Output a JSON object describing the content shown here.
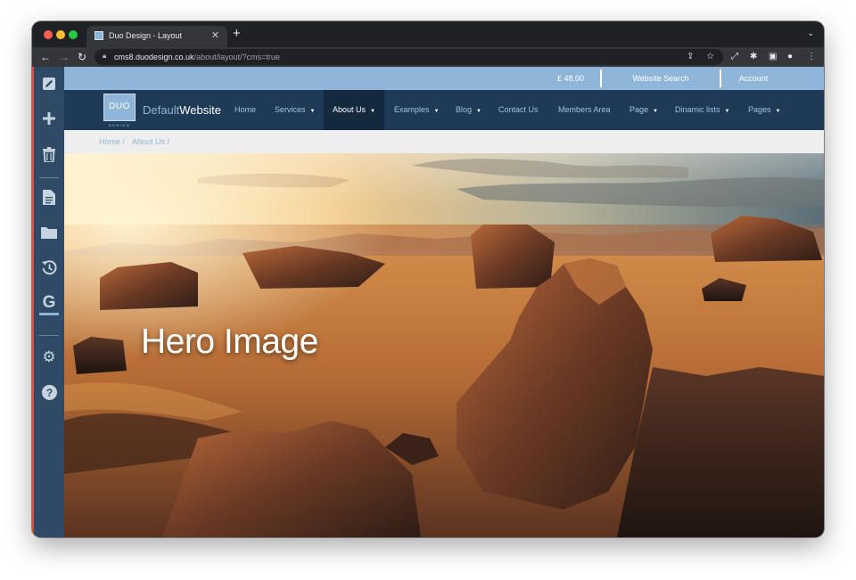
{
  "browser": {
    "tab_title": "Duo Design - Layout",
    "tab_close": "✕",
    "new_tab": "+",
    "url_host": "cms8.duodesign.co.uk",
    "url_path": "/about/layout/?cms=true"
  },
  "cms_sidebar": {
    "icons": [
      "edit-icon",
      "add-icon",
      "trash-icon",
      "page-icon",
      "folder-icon",
      "history-icon",
      "google-icon",
      "settings-icon",
      "help-icon"
    ]
  },
  "util_bar": {
    "basket": "£ 48.00",
    "search": "Website Search",
    "account": "Account"
  },
  "logo": {
    "text": "DUO",
    "sub": "DESIGN",
    "site_name_light": "Default",
    "site_name_bold": "Website"
  },
  "nav": {
    "items": [
      {
        "label": "Home",
        "dropdown": false
      },
      {
        "label": "Services",
        "dropdown": true
      },
      {
        "label": "About Us",
        "dropdown": true,
        "active": true
      },
      {
        "label": "Examples",
        "dropdown": true
      },
      {
        "label": "Blog",
        "dropdown": true
      },
      {
        "label": "Contact Us",
        "dropdown": false
      },
      {
        "label": "Members Area",
        "dropdown": false
      },
      {
        "label": "Page",
        "dropdown": true
      },
      {
        "label": "Dinamic lists",
        "dropdown": true
      },
      {
        "label": "Pages",
        "dropdown": true
      }
    ],
    "caret": "▼"
  },
  "breadcrumb": {
    "home": "Home /",
    "about": "About Us /"
  },
  "hero": {
    "title": "Hero Image"
  },
  "colors": {
    "util_bar": "#8fb6d8",
    "nav_bg": "#1f3a56",
    "nav_active": "#14293e",
    "cms_sidebar": "#2f4a66",
    "cms_accent": "#e14b3b"
  }
}
